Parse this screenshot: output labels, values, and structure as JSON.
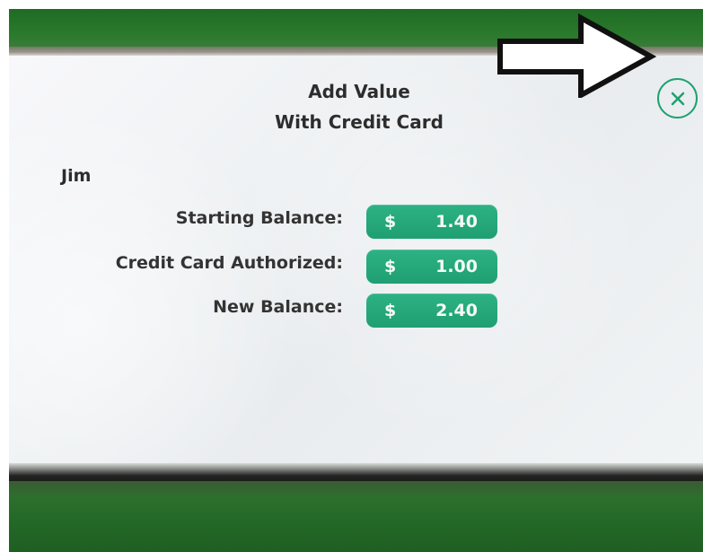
{
  "dialog": {
    "title_line1": "Add Value",
    "title_line2": "With Credit Card",
    "user_name": "Jim",
    "rows": [
      {
        "label": "Starting Balance:",
        "currency": "$",
        "amount": "1.40"
      },
      {
        "label": "Credit Card Authorized:",
        "currency": "$",
        "amount": "1.00"
      },
      {
        "label": "New Balance:",
        "currency": "$",
        "amount": "2.40"
      }
    ]
  },
  "icons": {
    "close": "close-icon",
    "annotation_arrow": "right-arrow-icon"
  },
  "colors": {
    "accent": "#1ea16f",
    "pill": "#29aa7c",
    "text": "#333333",
    "bezel": "#2b7a2d"
  }
}
